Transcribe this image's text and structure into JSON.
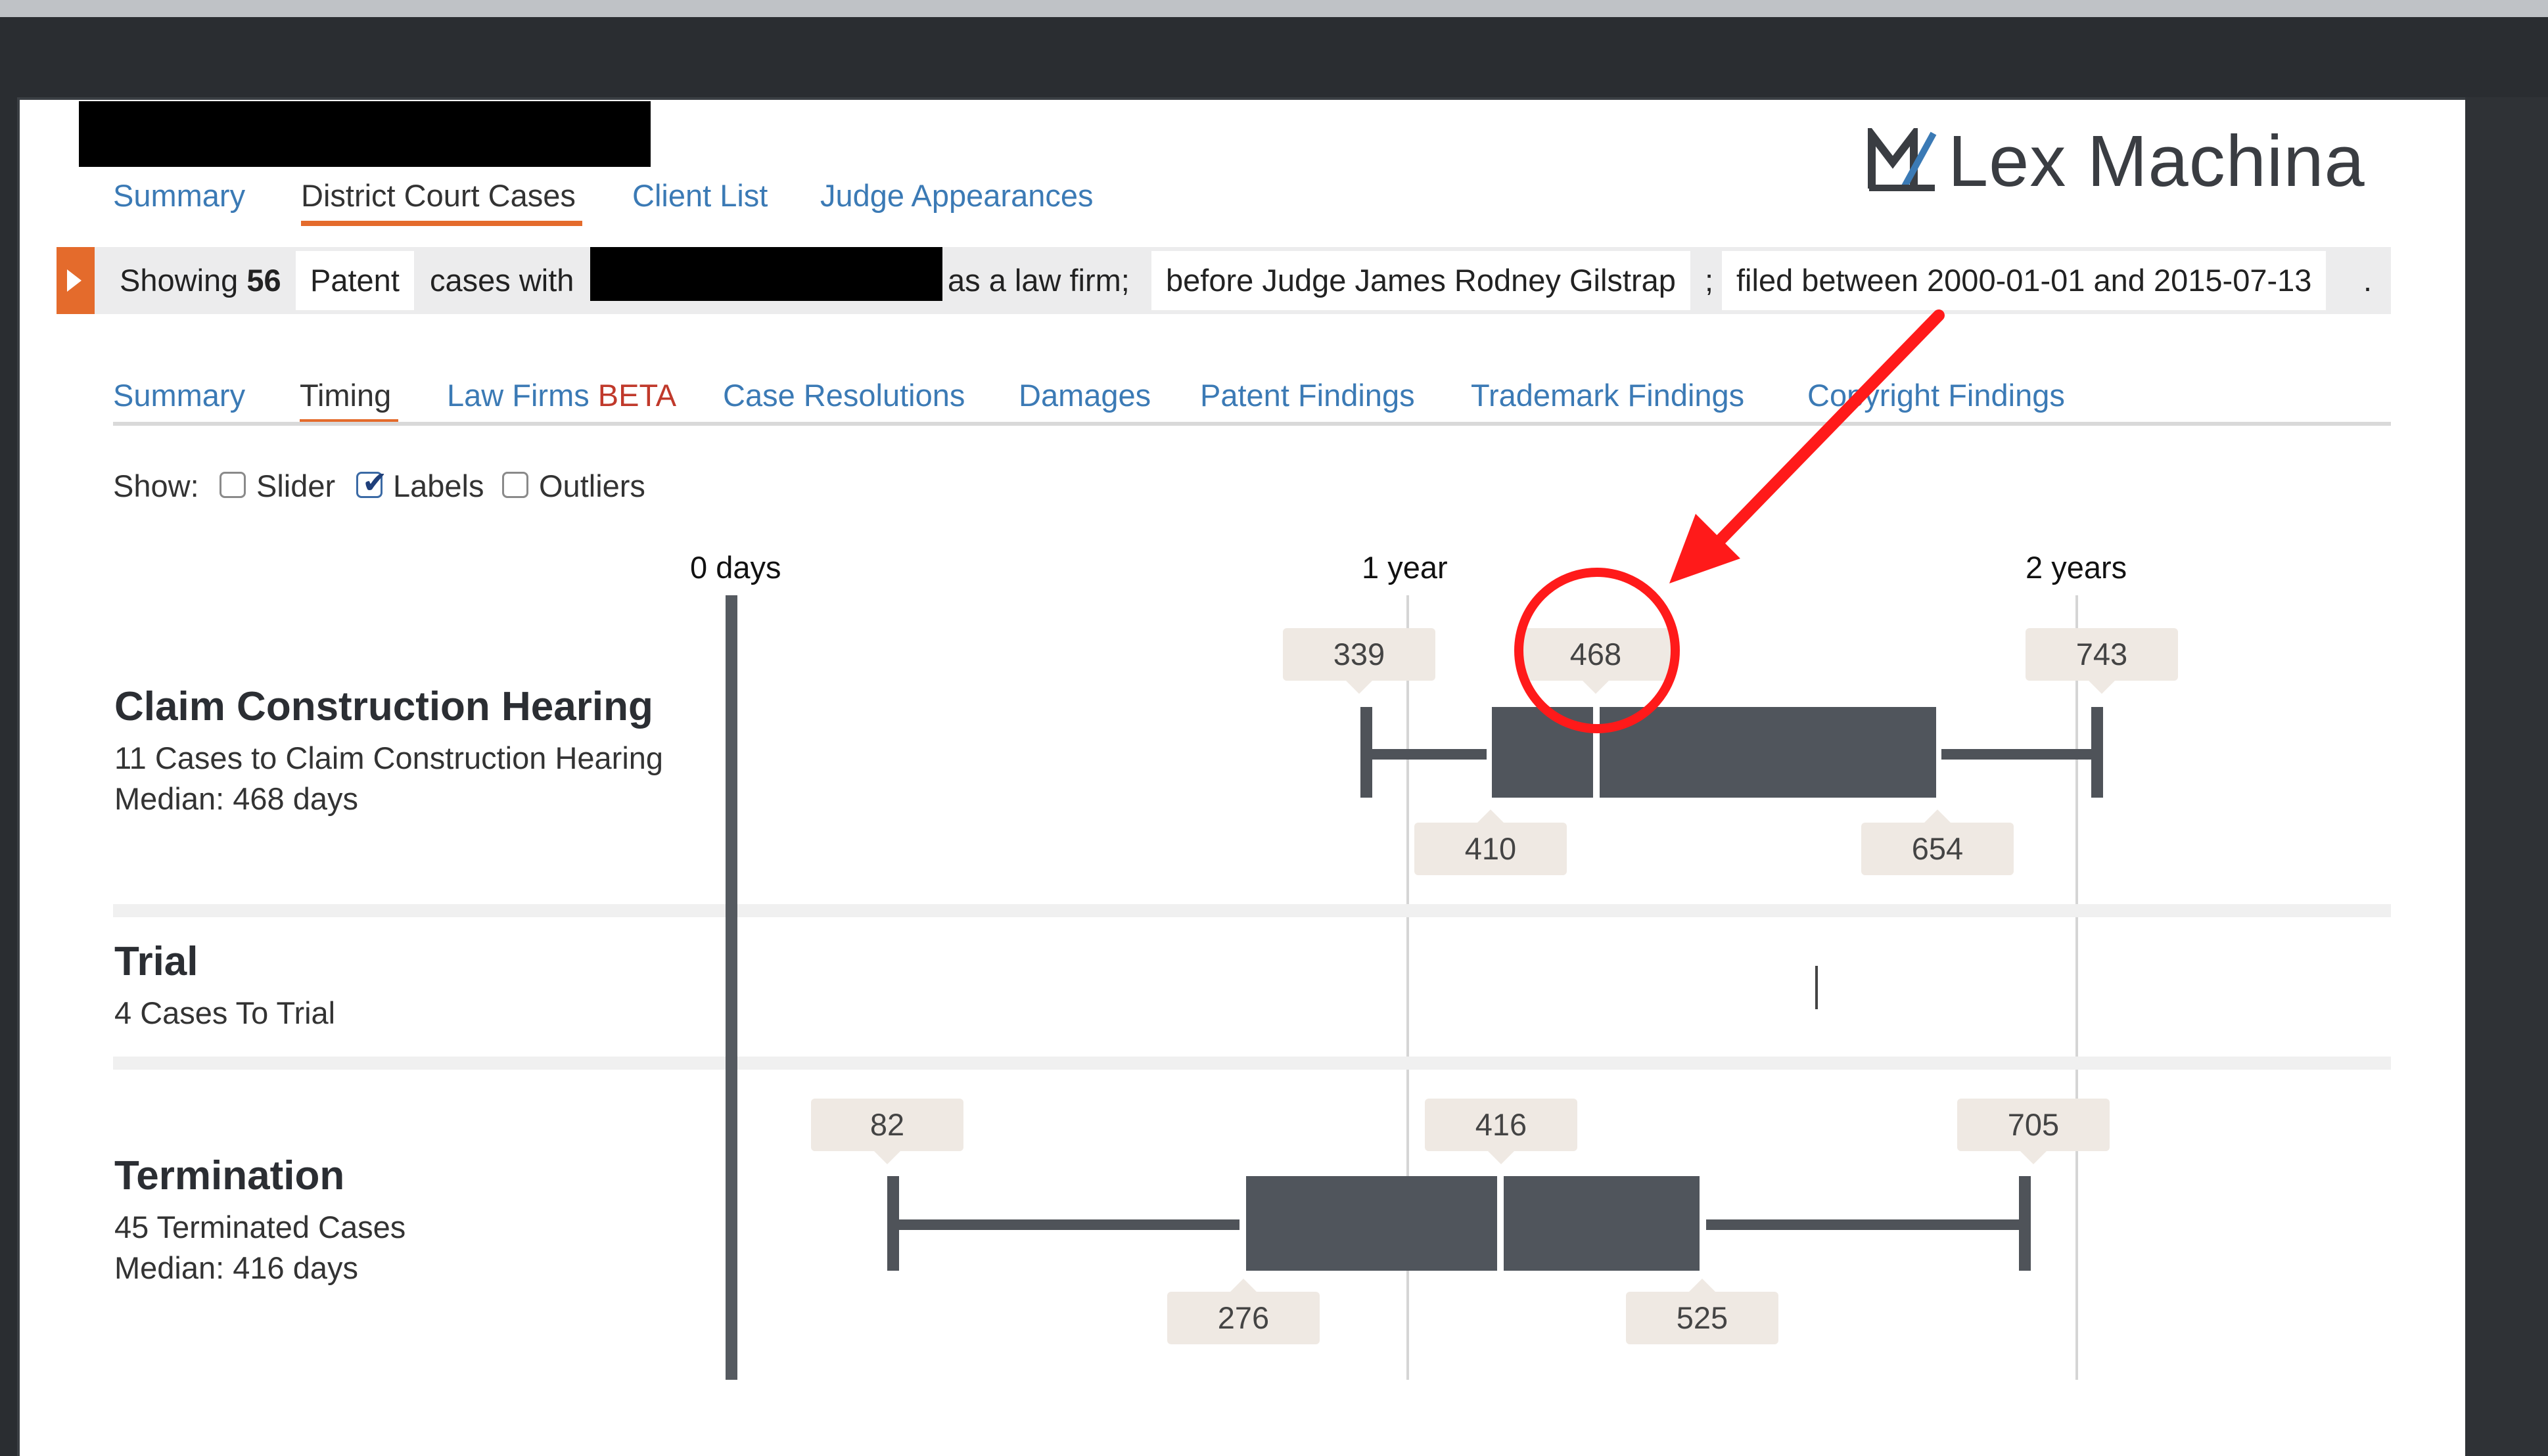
{
  "top_tabs": [
    {
      "label": "Summary",
      "active": false
    },
    {
      "label": "District Court Cases",
      "active": true
    },
    {
      "label": "Client List",
      "active": false
    },
    {
      "label": "Judge Appearances",
      "active": false
    }
  ],
  "logo": {
    "text": "Lex Machina"
  },
  "filter": {
    "showing_prefix": "Showing",
    "count": "56",
    "case_type": "Patent",
    "cases_with": "cases with",
    "as_law_firm": "as a law firm;",
    "judge": "before Judge James Rodney Gilstrap",
    "semicolon": ";",
    "dates": "filed between 2000-01-01 and 2015-07-13",
    "period": "."
  },
  "sub_tabs": [
    {
      "label": "Summary",
      "active": false
    },
    {
      "label": "Timing",
      "active": true
    },
    {
      "label": "Law Firms",
      "beta": "BETA",
      "active": false
    },
    {
      "label": "Case Resolutions",
      "active": false
    },
    {
      "label": "Damages",
      "active": false
    },
    {
      "label": "Patent Findings",
      "active": false
    },
    {
      "label": "Trademark Findings",
      "active": false
    },
    {
      "label": "Copyright Findings",
      "active": false
    }
  ],
  "show": {
    "label": "Show:",
    "options": [
      {
        "label": "Slider",
        "checked": false
      },
      {
        "label": "Labels",
        "checked": true
      },
      {
        "label": "Outliers",
        "checked": false
      }
    ]
  },
  "timeline": {
    "axis_labels": [
      "0 days",
      "1 year",
      "2 years"
    ],
    "rows": [
      {
        "title": "Claim Construction Hearing",
        "subtitle": "11 Cases to Claim Construction Hearing",
        "median_text": "Median: 468 days",
        "min": "339",
        "q1": "410",
        "median": "468",
        "q3": "654",
        "max": "743"
      },
      {
        "title": "Trial",
        "subtitle": "4 Cases To Trial"
      },
      {
        "title": "Termination",
        "subtitle": "45 Terminated Cases",
        "median_text": "Median: 416 days",
        "min": "82",
        "q1": "276",
        "median": "416",
        "q3": "525",
        "max": "705"
      }
    ]
  },
  "colors": {
    "accent": "#e46b2c",
    "link": "#3b7ab5",
    "box": "#50555c",
    "highlight": "#ff1a1a"
  }
}
